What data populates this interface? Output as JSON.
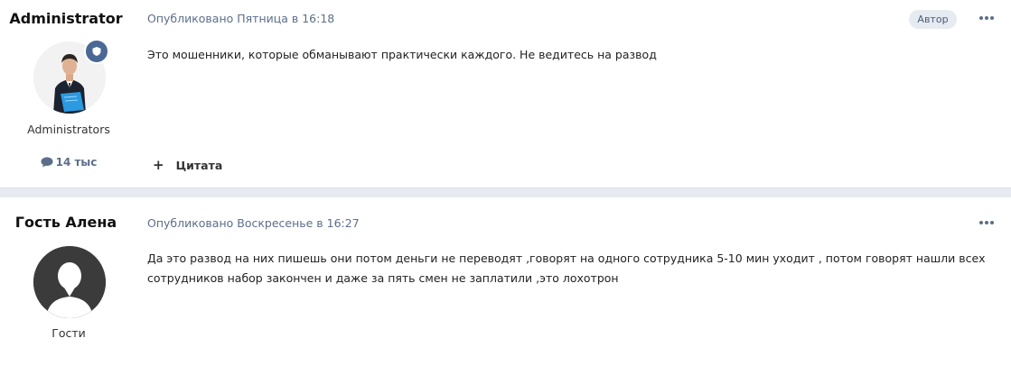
{
  "posts": [
    {
      "author": "Administrator",
      "published": "Опубликовано Пятница в 16:18",
      "tag": "Автор",
      "group": "Administrators",
      "count": "14 тыс",
      "text": "Это мошенники, которые обманывают практически каждого. Не ведитесь на развод",
      "quote_label": "Цитата",
      "quote_symbol": "+"
    },
    {
      "author": "Гость Алена",
      "published": "Опубликовано Воскресенье в 16:27",
      "group": "Гости",
      "text": "Да это развод на них пишешь они потом деньги не переводят ,говорят на одного сотрудника 5-10 мин уходит , потом говорят нашли всех сотрудников набор закончен и даже за пять смен не заплатили ,это лохотрон"
    }
  ],
  "icons": {
    "badge": "shield-icon",
    "count": "speech-bubble-icon",
    "more": "ellipsis-icon"
  },
  "colors": {
    "accent": "#4b6894",
    "meta": "#5c6f8a",
    "separator": "#e7eaf0"
  }
}
